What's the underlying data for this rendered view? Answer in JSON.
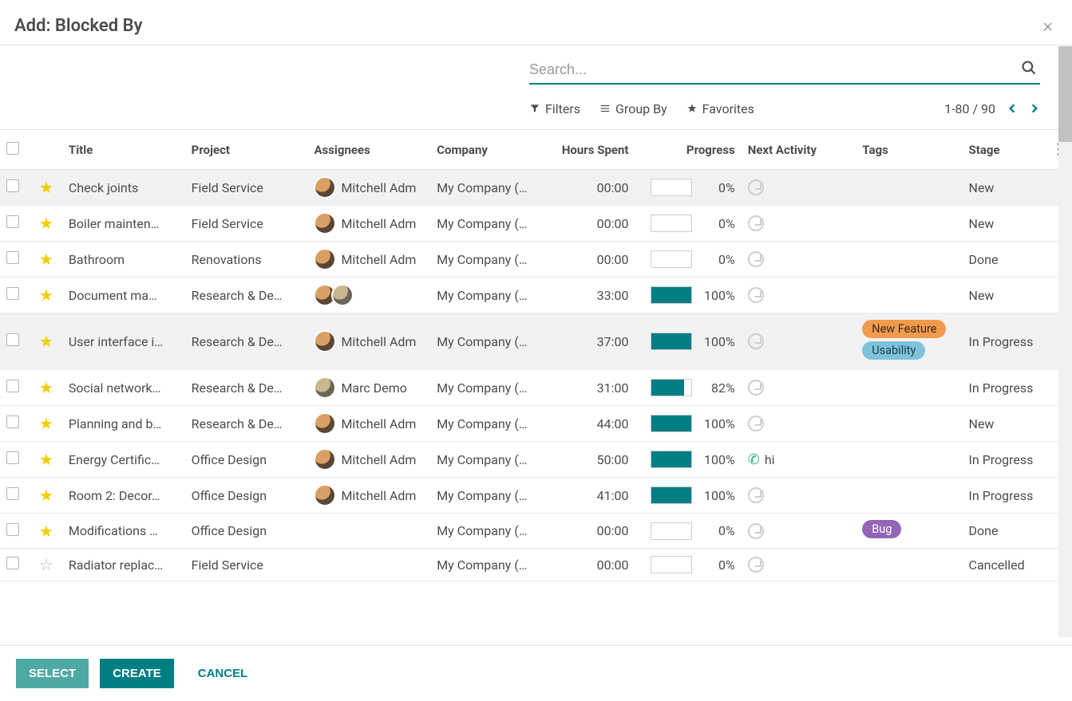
{
  "header": {
    "title": "Add: Blocked By"
  },
  "search": {
    "placeholder": "Search..."
  },
  "filters": {
    "filters": "Filters",
    "groupby": "Group By",
    "favorites": "Favorites"
  },
  "pager": {
    "count": "1-80 / 90"
  },
  "columns": {
    "title": "Title",
    "project": "Project",
    "assignees": "Assignees",
    "company": "Company",
    "hours": "Hours Spent",
    "progress": "Progress",
    "activity": "Next Activity",
    "tags": "Tags",
    "stage": "Stage"
  },
  "rows": [
    {
      "star": true,
      "title": "Check joints",
      "project": "Field Service",
      "asgn_text": "Mitchell Adm",
      "avatars": [
        "a"
      ],
      "company": "My Company (…",
      "hours": "00:00",
      "prog": 0,
      "pct": "0%",
      "activity": "clock",
      "tags": [],
      "stage": "New",
      "sel": true
    },
    {
      "star": true,
      "title": "Boiler mainten…",
      "project": "Field Service",
      "asgn_text": "Mitchell Adm",
      "avatars": [
        "a"
      ],
      "company": "My Company (…",
      "hours": "00:00",
      "prog": 0,
      "pct": "0%",
      "activity": "clock",
      "tags": [],
      "stage": "New"
    },
    {
      "star": true,
      "title": "Bathroom",
      "project": "Renovations",
      "asgn_text": "Mitchell Adm",
      "avatars": [
        "a"
      ],
      "company": "My Company (…",
      "hours": "00:00",
      "prog": 0,
      "pct": "0%",
      "activity": "clock",
      "tags": [],
      "stage": "Done"
    },
    {
      "star": true,
      "title": "Document ma…",
      "project": "Research & De…",
      "asgn_text": "",
      "avatars": [
        "a",
        "b"
      ],
      "company": "My Company (…",
      "hours": "33:00",
      "prog": 100,
      "pct": "100%",
      "activity": "clock",
      "tags": [],
      "stage": "New"
    },
    {
      "star": true,
      "title": "User interface i…",
      "project": "Research & De…",
      "asgn_text": "Mitchell Adm",
      "avatars": [
        "a"
      ],
      "company": "My Company (…",
      "hours": "37:00",
      "prog": 100,
      "pct": "100%",
      "activity": "clock",
      "tags": [
        {
          "text": "New Feature",
          "cls": "tag-orange"
        },
        {
          "text": "Usability",
          "cls": "tag-blue"
        }
      ],
      "stage": "In Progress",
      "sel": true
    },
    {
      "star": true,
      "title": "Social network…",
      "project": "Research & De…",
      "asgn_text": "Marc Demo",
      "avatars": [
        "b"
      ],
      "company": "My Company (…",
      "hours": "31:00",
      "prog": 82,
      "pct": "82%",
      "activity": "clock",
      "tags": [],
      "stage": "In Progress"
    },
    {
      "star": true,
      "title": "Planning and b…",
      "project": "Research & De…",
      "asgn_text": "Mitchell Adm",
      "avatars": [
        "a"
      ],
      "company": "My Company (…",
      "hours": "44:00",
      "prog": 100,
      "pct": "100%",
      "activity": "clock",
      "tags": [],
      "stage": "New"
    },
    {
      "star": true,
      "title": "Energy Certific…",
      "project": "Office Design",
      "asgn_text": "Mitchell Adm",
      "avatars": [
        "a"
      ],
      "company": "My Company (…",
      "hours": "50:00",
      "prog": 100,
      "pct": "100%",
      "activity": "phone",
      "act_text": "hi",
      "tags": [],
      "stage": "In Progress"
    },
    {
      "star": true,
      "title": "Room 2: Decor…",
      "project": "Office Design",
      "asgn_text": "Mitchell Adm",
      "avatars": [
        "a"
      ],
      "company": "My Company (…",
      "hours": "41:00",
      "prog": 100,
      "pct": "100%",
      "activity": "clock",
      "tags": [],
      "stage": "In Progress"
    },
    {
      "star": true,
      "title": "Modifications …",
      "project": "Office Design",
      "asgn_text": "",
      "avatars": [],
      "company": "My Company (…",
      "hours": "00:00",
      "prog": 0,
      "pct": "0%",
      "activity": "clock",
      "tags": [
        {
          "text": "Bug",
          "cls": "tag-purple"
        }
      ],
      "stage": "Done"
    },
    {
      "star": false,
      "title": "Radiator replac…",
      "project": "Field Service",
      "asgn_text": "",
      "avatars": [],
      "company": "My Company (…",
      "hours": "00:00",
      "prog": 0,
      "pct": "0%",
      "activity": "clock",
      "tags": [],
      "stage": "Cancelled"
    }
  ],
  "footer": {
    "select": "SELECT",
    "create": "CREATE",
    "cancel": "CANCEL"
  }
}
